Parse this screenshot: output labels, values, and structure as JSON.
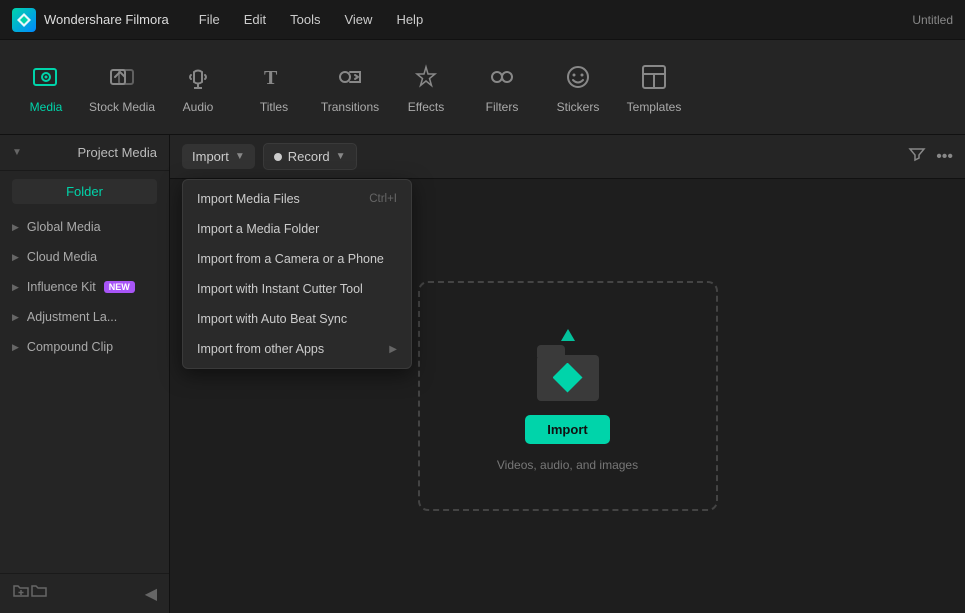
{
  "app": {
    "name": "Wondershare Filmora",
    "window_title": "Untitled"
  },
  "menu": {
    "items": [
      "File",
      "Edit",
      "Tools",
      "View",
      "Help"
    ]
  },
  "toolbar": {
    "items": [
      {
        "id": "media",
        "label": "Media",
        "icon": "media",
        "active": true
      },
      {
        "id": "stock-media",
        "label": "Stock Media",
        "icon": "stock-media",
        "active": false
      },
      {
        "id": "audio",
        "label": "Audio",
        "icon": "audio",
        "active": false
      },
      {
        "id": "titles",
        "label": "Titles",
        "icon": "titles",
        "active": false
      },
      {
        "id": "transitions",
        "label": "Transitions",
        "icon": "transitions",
        "active": false
      },
      {
        "id": "effects",
        "label": "Effects",
        "icon": "effects",
        "active": false
      },
      {
        "id": "filters",
        "label": "Filters",
        "icon": "filters",
        "active": false
      },
      {
        "id": "stickers",
        "label": "Stickers",
        "icon": "stickers",
        "active": false
      },
      {
        "id": "templates",
        "label": "Templates",
        "icon": "templates",
        "active": false
      }
    ]
  },
  "sidebar": {
    "header": "Project Media",
    "folder_btn": "Folder",
    "sections": [
      {
        "id": "global-media",
        "label": "Global Media",
        "badge": null
      },
      {
        "id": "cloud-media",
        "label": "Cloud Media",
        "badge": null
      },
      {
        "id": "influence-kit",
        "label": "Influence Kit",
        "badge": "NEW"
      },
      {
        "id": "adjustment-layer",
        "label": "Adjustment La...",
        "badge": null
      },
      {
        "id": "compound-clip",
        "label": "Compound Clip",
        "badge": null
      }
    ]
  },
  "content_toolbar": {
    "import_label": "Import",
    "record_label": "Record",
    "record_dot_label": "●"
  },
  "import_dropdown": {
    "items": [
      {
        "id": "import-media-files",
        "label": "Import Media Files",
        "shortcut": "Ctrl+I",
        "arrow": false
      },
      {
        "id": "import-media-folder",
        "label": "Import a Media Folder",
        "shortcut": "",
        "arrow": false
      },
      {
        "id": "import-camera-phone",
        "label": "Import from a Camera or a Phone",
        "shortcut": "",
        "arrow": false
      },
      {
        "id": "import-instant-cutter",
        "label": "Import with Instant Cutter Tool",
        "shortcut": "",
        "arrow": false
      },
      {
        "id": "import-auto-beat",
        "label": "Import with Auto Beat Sync",
        "shortcut": "",
        "arrow": false
      },
      {
        "id": "import-other-apps",
        "label": "Import from other Apps",
        "shortcut": "",
        "arrow": true
      }
    ]
  },
  "drop_zone": {
    "import_btn_label": "Import",
    "hint_text": "Videos, audio, and images"
  }
}
